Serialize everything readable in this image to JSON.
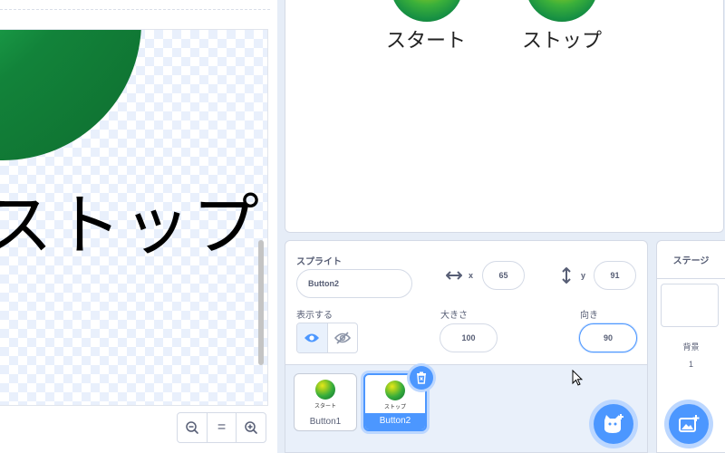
{
  "editor": {
    "canvas_text": "ストップ",
    "zoom": {
      "out_icon": "zoom-out-icon",
      "reset_icon": "zoom-reset-icon",
      "in_icon": "zoom-in-icon",
      "reset_label": "="
    }
  },
  "stage": {
    "sprites": [
      {
        "label": "スタート"
      },
      {
        "label": "ストップ"
      }
    ]
  },
  "sprite_info": {
    "title": "スプライト",
    "name_value": "Button2",
    "x_label": "x",
    "x_value": "65",
    "y_label": "y",
    "y_value": "91",
    "show_label": "表示する",
    "size_label": "大きさ",
    "size_value": "100",
    "direction_label": "向き",
    "direction_value": "90"
  },
  "sprite_list": [
    {
      "name": "Button1",
      "thumb_text": "スタート",
      "selected": false
    },
    {
      "name": "Button2",
      "thumb_text": "ストップ",
      "selected": true
    }
  ],
  "stage_panel": {
    "title": "ステージ",
    "backdrops_label": "背景",
    "backdrops_count": "1"
  },
  "colors": {
    "accent": "#4c97ff",
    "accent_light": "#bcd7ff",
    "text": "#575e75",
    "panel_bg": "#e9f0fa"
  }
}
